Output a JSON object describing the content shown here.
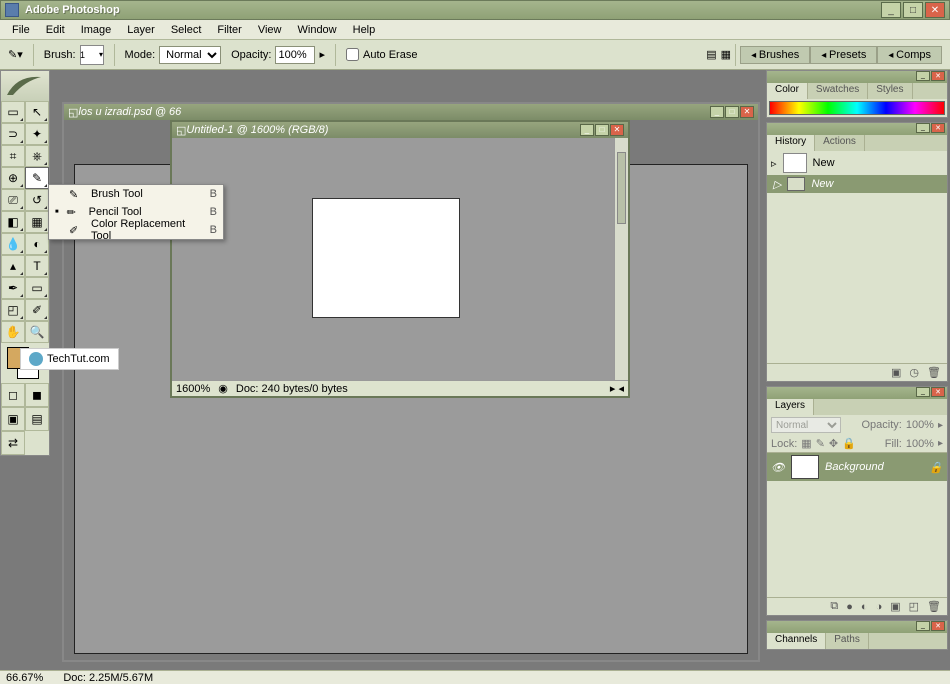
{
  "app": {
    "title": "Adobe Photoshop"
  },
  "menu": [
    "File",
    "Edit",
    "Image",
    "Layer",
    "Select",
    "Filter",
    "View",
    "Window",
    "Help"
  ],
  "options": {
    "brush_label": "Brush:",
    "brush_size": "1",
    "mode_label": "Mode:",
    "mode_value": "Normal",
    "opacity_label": "Opacity:",
    "opacity_value": "100%",
    "auto_erase": "Auto Erase",
    "wells": [
      "Brushes",
      "Presets",
      "Comps"
    ]
  },
  "flyout": {
    "items": [
      {
        "label": "Brush Tool",
        "key": "B",
        "selected": false
      },
      {
        "label": "Pencil Tool",
        "key": "B",
        "selected": true
      },
      {
        "label": "Color Replacement Tool",
        "key": "B",
        "selected": false
      }
    ]
  },
  "bg_doc": {
    "title": "los u izradi.psd @ 66"
  },
  "front_doc": {
    "title": "Untitled-1 @ 1600% (RGB/8)",
    "zoom": "1600%",
    "doc_info": "Doc: 240 bytes/0 bytes"
  },
  "color_panel": {
    "tabs": [
      "Color",
      "Swatches",
      "Styles"
    ]
  },
  "history_panel": {
    "tabs": [
      "History",
      "Actions"
    ],
    "snapshot": "New",
    "state": "New"
  },
  "layers_panel": {
    "tabs": [
      "Layers"
    ],
    "blend": "Normal",
    "opacity_label": "Opacity:",
    "opacity": "100%",
    "lock_label": "Lock:",
    "fill_label": "Fill:",
    "fill": "100%",
    "layer_name": "Background"
  },
  "channels_panel": {
    "tabs": [
      "Channels",
      "Paths"
    ]
  },
  "watermark": "TechTut.com",
  "status": {
    "zoom": "66.67%",
    "doc": "Doc: 2.25M/5.67M"
  },
  "colors": {
    "fg": "#d4a860",
    "bg": "#ffffff"
  }
}
